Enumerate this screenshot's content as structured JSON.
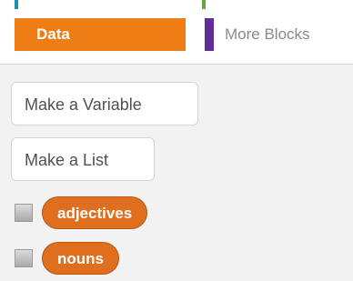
{
  "categories": {
    "active": {
      "label": "Data",
      "color": "#ee7d16"
    },
    "more_blocks": {
      "label": "More Blocks",
      "color": "#632d99"
    }
  },
  "palette": {
    "make_variable_label": "Make a Variable",
    "make_list_label": "Make a List",
    "variables": [
      {
        "name": "adjectives",
        "checked": false
      },
      {
        "name": "nouns",
        "checked": false
      }
    ]
  },
  "colors": {
    "reporter": "#e06e1f",
    "top_strip_left": "#1f8fb0",
    "top_strip_mid": "#6aa33f"
  }
}
